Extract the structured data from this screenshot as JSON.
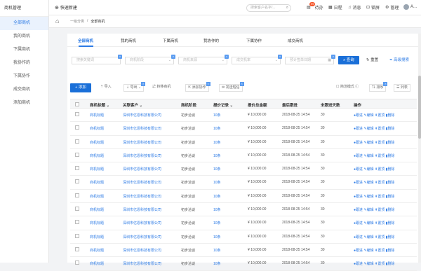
{
  "sidebar": {
    "title": "商机管理",
    "items": [
      {
        "label": "全部商机",
        "active": true
      },
      {
        "label": "我的商机",
        "active": false
      },
      {
        "label": "下属商机",
        "active": false
      },
      {
        "label": "我协作的",
        "active": false
      },
      {
        "label": "下属协作",
        "active": false
      },
      {
        "label": "成交商机",
        "active": false
      },
      {
        "label": "添加商机",
        "active": false
      }
    ]
  },
  "topbar": {
    "quick_new": "快速新建",
    "search_placeholder": "搜索客户名字/...",
    "todo": "待办",
    "todo_count": "99",
    "schedule": "日程",
    "message": "消息",
    "lock": "锁屏",
    "manage": "管理",
    "user": "A..."
  },
  "breadcrumb": {
    "level1": "一级分类",
    "level2": "全部商机"
  },
  "tabs": [
    "全部商机",
    "我的商机",
    "下属商机",
    "我协作的",
    "下属协作",
    "成交商机"
  ],
  "filters": {
    "f1": "搜索关键词",
    "f2": "商机阶段",
    "f3": "商机来源",
    "f4": "成交机率",
    "f5": "预计签单日期",
    "query": "查询",
    "reset": "重置",
    "advanced": "高级搜索"
  },
  "toolbar": {
    "add": "添加",
    "import": "导入",
    "export": "导出",
    "transfer": "转移商机",
    "add_collab": "添加协作",
    "send_sms": "发送短信",
    "simple_mode": "简洁模式",
    "sort": "排序",
    "columns": "列表"
  },
  "table": {
    "headers": [
      "商机标题",
      "关联客户",
      "商机阶段",
      "报价记录",
      "报价总金额",
      "最后跟进",
      "未跟进天数",
      "操作"
    ],
    "rows": [
      {
        "title": "商机标题",
        "customer": "深圳市亿恩科技有限公司",
        "stage": "初步洽谈",
        "quotes": "10条",
        "amount": "¥ 10,000.00",
        "last": "2018-08-25 14:54",
        "days": "30"
      },
      {
        "title": "商机标题",
        "customer": "深圳市亿恩科技有限公司",
        "stage": "初步洽谈",
        "quotes": "10条",
        "amount": "¥ 10,000.00",
        "last": "2018-08-25 14:54",
        "days": "30"
      },
      {
        "title": "商机标题",
        "customer": "深圳市亿恩科技有限公司",
        "stage": "初步洽谈",
        "quotes": "10条",
        "amount": "¥ 10,000.00",
        "last": "2018-08-25 14:54",
        "days": "30"
      },
      {
        "title": "商机标题",
        "customer": "深圳市亿恩科技有限公司",
        "stage": "初步洽谈",
        "quotes": "10条",
        "amount": "¥ 10,000.00",
        "last": "2018-08-25 14:54",
        "days": "30"
      },
      {
        "title": "商机标题",
        "customer": "深圳市亿恩科技有限公司",
        "stage": "初步洽谈",
        "quotes": "10条",
        "amount": "¥ 10,000.00",
        "last": "2018-08-25 14:54",
        "days": "30"
      },
      {
        "title": "商机标题",
        "customer": "深圳市亿恩科技有限公司",
        "stage": "初步洽谈",
        "quotes": "10条",
        "amount": "¥ 10,000.00",
        "last": "2018-08-25 14:54",
        "days": "30"
      },
      {
        "title": "商机标题",
        "customer": "深圳市亿恩科技有限公司",
        "stage": "初步洽谈",
        "quotes": "10条",
        "amount": "¥ 10,000.00",
        "last": "2018-08-25 14:54",
        "days": "30"
      },
      {
        "title": "商机标题",
        "customer": "深圳市亿恩科技有限公司",
        "stage": "初步洽谈",
        "quotes": "10条",
        "amount": "¥ 10,000.00",
        "last": "2018-08-25 14:54",
        "days": "30"
      },
      {
        "title": "商机标题",
        "customer": "深圳市亿恩科技有限公司",
        "stage": "初步洽谈",
        "quotes": "10条",
        "amount": "¥ 10,000.00",
        "last": "2018-08-25 14:54",
        "days": "30"
      },
      {
        "title": "商机标题",
        "customer": "深圳市亿恩科技有限公司",
        "stage": "初步洽谈",
        "quotes": "10条",
        "amount": "¥ 10,000.00",
        "last": "2018-08-25 14:54",
        "days": "30"
      },
      {
        "title": "商机标题",
        "customer": "深圳市亿恩科技有限公司",
        "stage": "初步洽谈",
        "quotes": "10条",
        "amount": "¥ 10,000.00",
        "last": "2018-08-25 14:54",
        "days": "30"
      },
      {
        "title": "商机标题",
        "customer": "深圳市亿恩科技有限公司",
        "stage": "初步洽谈",
        "quotes": "10条",
        "amount": "¥ 10,000.00",
        "last": "2018-08-25 14:54",
        "days": "30"
      }
    ],
    "actions": {
      "follow": "跟进",
      "edit": "编辑",
      "transfer": "置顶",
      "delete": "删除"
    }
  },
  "colors": {
    "accent": "#1a6fd8",
    "link": "#2d7be5",
    "badge": "#f5582d"
  }
}
